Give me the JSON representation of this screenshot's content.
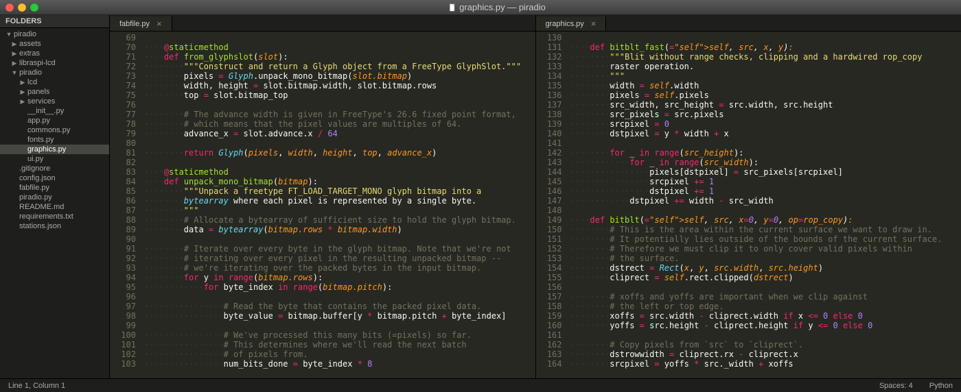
{
  "window": {
    "title": "graphics.py — piradio"
  },
  "sidebar": {
    "header": "FOLDERS",
    "items": [
      {
        "label": "piradio",
        "depth": 0,
        "arrow": "▼",
        "folder": true
      },
      {
        "label": "assets",
        "depth": 1,
        "arrow": "▶",
        "folder": true
      },
      {
        "label": "extras",
        "depth": 1,
        "arrow": "▶",
        "folder": true
      },
      {
        "label": "libraspi-lcd",
        "depth": 1,
        "arrow": "▶",
        "folder": true
      },
      {
        "label": "piradio",
        "depth": 1,
        "arrow": "▼",
        "folder": true
      },
      {
        "label": "lcd",
        "depth": 2,
        "arrow": "▶",
        "folder": true
      },
      {
        "label": "panels",
        "depth": 2,
        "arrow": "▶",
        "folder": true
      },
      {
        "label": "services",
        "depth": 2,
        "arrow": "▶",
        "folder": true
      },
      {
        "label": "__init__.py",
        "depth": 2,
        "folder": false
      },
      {
        "label": "app.py",
        "depth": 2,
        "folder": false
      },
      {
        "label": "commons.py",
        "depth": 2,
        "folder": false
      },
      {
        "label": "fonts.py",
        "depth": 2,
        "folder": false
      },
      {
        "label": "graphics.py",
        "depth": 2,
        "folder": false,
        "selected": true
      },
      {
        "label": "ui.py",
        "depth": 2,
        "folder": false
      },
      {
        "label": ".gitignore",
        "depth": 1,
        "folder": false
      },
      {
        "label": "config.json",
        "depth": 1,
        "folder": false
      },
      {
        "label": "fabfile.py",
        "depth": 1,
        "folder": false
      },
      {
        "label": "piradio.py",
        "depth": 1,
        "folder": false
      },
      {
        "label": "README.md",
        "depth": 1,
        "folder": false
      },
      {
        "label": "requirements.txt",
        "depth": 1,
        "folder": false
      },
      {
        "label": "stations.json",
        "depth": 1,
        "folder": false
      }
    ]
  },
  "panes": [
    {
      "tab": "fabfile.py",
      "lineStart": 69,
      "lines": [
        "",
        "    @staticmethod",
        "    def from_glyphslot(slot):",
        "        \"\"\"Construct and return a Glyph object from a FreeType GlyphSlot.\"\"\"",
        "        pixels = Glyph.unpack_mono_bitmap(slot.bitmap)",
        "        width, height = slot.bitmap.width, slot.bitmap.rows",
        "        top = slot.bitmap_top",
        "",
        "        # The advance width is given in FreeType's 26.6 fixed point format,",
        "        # which means that the pixel values are multiples of 64.",
        "        advance_x = slot.advance.x / 64",
        "",
        "        return Glyph(pixels, width, height, top, advance_x)",
        "",
        "    @staticmethod",
        "    def unpack_mono_bitmap(bitmap):",
        "        \"\"\"Unpack a freetype FT_LOAD_TARGET_MONO glyph bitmap into a",
        "        bytearray where each pixel is represented by a single byte.",
        "        \"\"\"",
        "        # Allocate a bytearray of sufficient size to hold the glyph bitmap.",
        "        data = bytearray(bitmap.rows * bitmap.width)",
        "",
        "        # Iterate over every byte in the glyph bitmap. Note that we're not",
        "        # iterating over every pixel in the resulting unpacked bitmap --",
        "        # we're iterating over the packed bytes in the input bitmap.",
        "        for y in range(bitmap.rows):",
        "            for byte_index in range(bitmap.pitch):",
        "",
        "                # Read the byte that contains the packed pixel data.",
        "                byte_value = bitmap.buffer[y * bitmap.pitch + byte_index]",
        "",
        "                # We've processed this many bits (=pixels) so far.",
        "                # This determines where we'll read the next batch",
        "                # of pixels from.",
        "                num_bits_done = byte_index * 8"
      ]
    },
    {
      "tab": "graphics.py",
      "lineStart": 130,
      "lines": [
        "",
        "    def bitblt_fast(self, src, x, y):",
        "        \"\"\"Blit without range checks, clipping and a hardwired rop_copy",
        "        raster operation.",
        "        \"\"\"",
        "        width = self.width",
        "        pixels = self.pixels",
        "        src_width, src_height = src.width, src.height",
        "        src_pixels = src.pixels",
        "        srcpixel = 0",
        "        dstpixel = y * width + x",
        "",
        "        for _ in range(src_height):",
        "            for _ in range(src_width):",
        "                pixels[dstpixel] = src_pixels[srcpixel]",
        "                srcpixel += 1",
        "                dstpixel += 1",
        "            dstpixel += width - src_width",
        "",
        "    def bitblt(self, src, x=0, y=0, op=rop_copy):",
        "        # This is the area within the current surface we want to draw in.",
        "        # It potentially lies outside of the bounds of the current surface.",
        "        # Therefore we must clip it to only cover valid pixels within",
        "        # the surface.",
        "        dstrect = Rect(x, y, src.width, src.height)",
        "        cliprect = self.rect.clipped(dstrect)",
        "",
        "        # xoffs and yoffs are important when we clip against",
        "        # the left or top edge.",
        "        xoffs = src.width - cliprect.width if x <= 0 else 0",
        "        yoffs = src.height - cliprect.height if y <= 0 else 0",
        "",
        "        # Copy pixels from `src` to `cliprect`.",
        "        dstrowwidth = cliprect.rx - cliprect.x",
        "        srcpixel = yoffs * src._width + xoffs"
      ]
    }
  ],
  "status": {
    "left": "Line 1, Column 1",
    "spaces": "Spaces: 4",
    "lang": "Python"
  }
}
